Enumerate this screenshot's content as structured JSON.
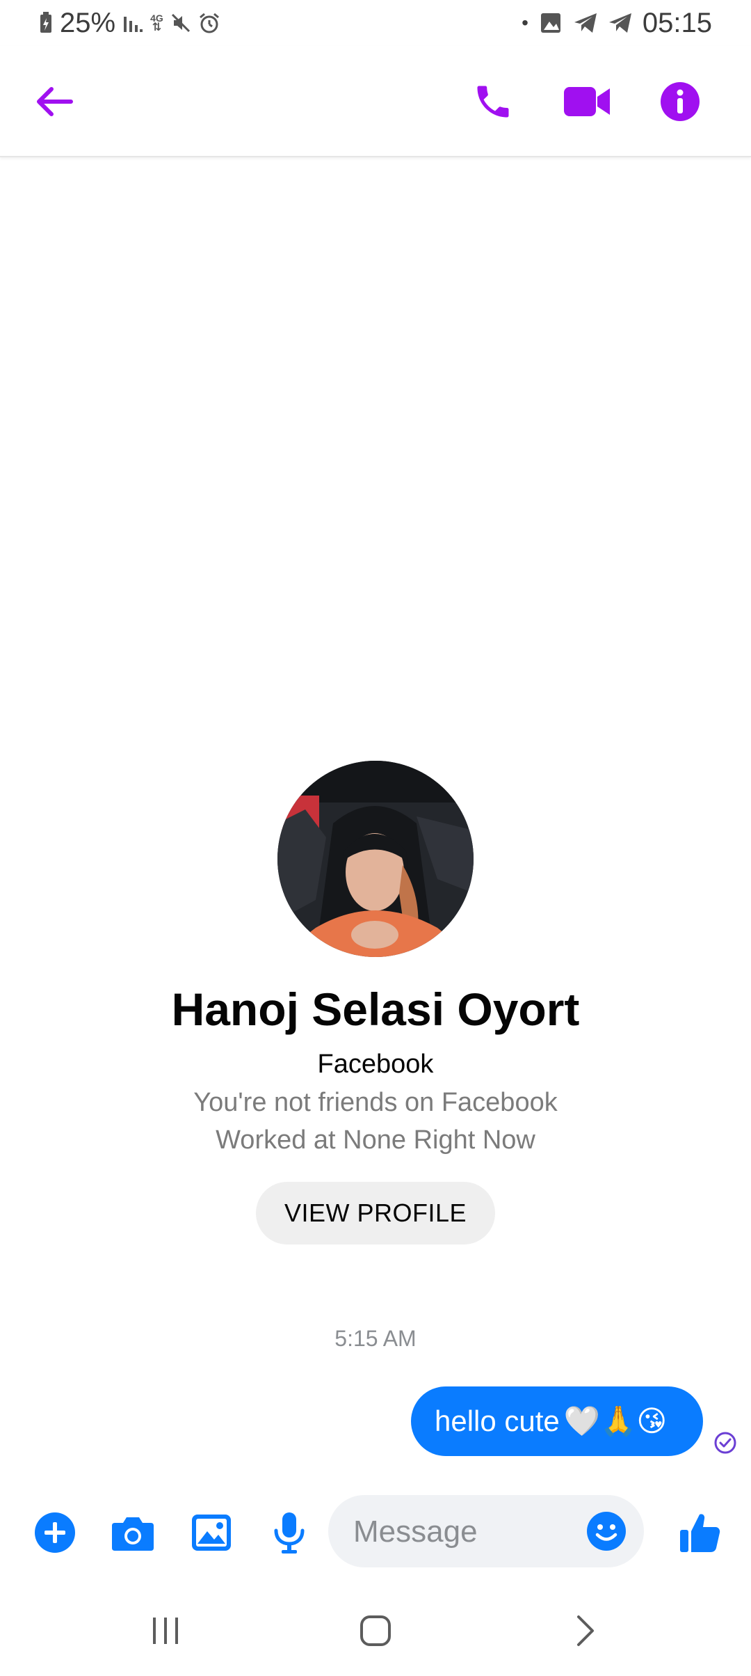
{
  "status_bar": {
    "battery": "25%",
    "network": "4G",
    "time": "05:15"
  },
  "header": {
    "back_icon": "arrow-left-icon",
    "call_icon": "phone-icon",
    "video_icon": "video-camera-icon",
    "info_icon": "info-icon",
    "accent_color": "#a010f0"
  },
  "profile": {
    "name": "Hanoj Selasi Oyort",
    "platform": "Facebook",
    "friend_status": "You're not friends on Facebook",
    "work": "Worked at None Right Now",
    "view_profile_label": "VIEW PROFILE"
  },
  "conversation": {
    "timestamp": "5:15 AM",
    "messages": [
      {
        "text": "hello cute",
        "emojis": "🤍🙏😘",
        "from_me": true,
        "color": "#0a7cff"
      }
    ]
  },
  "composer": {
    "placeholder": "Message",
    "accent_color": "#0a7cff",
    "icons": [
      "plus-icon",
      "camera-icon",
      "gallery-icon",
      "microphone-icon",
      "emoji-icon",
      "thumbs-up-icon"
    ]
  },
  "nav_bar": {
    "icons": [
      "recent-apps-icon",
      "home-icon",
      "back-icon"
    ]
  }
}
